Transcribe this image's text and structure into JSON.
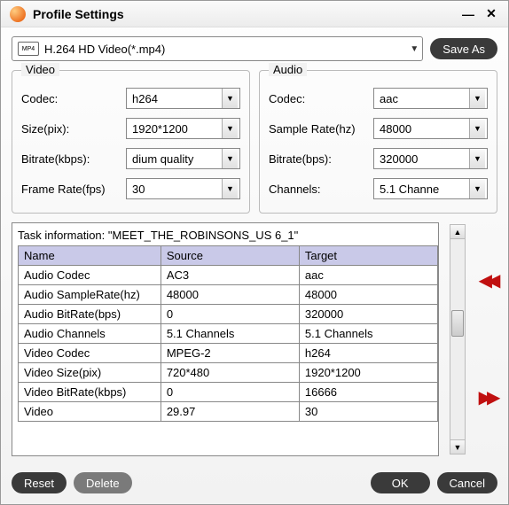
{
  "window": {
    "title": "Profile Settings"
  },
  "topbar": {
    "profile_label": "H.264 HD Video(*.mp4)",
    "format_badge": "MP4",
    "save_as_label": "Save As"
  },
  "video": {
    "legend": "Video",
    "codec_label": "Codec:",
    "codec_value": "h264",
    "size_label": "Size(pix):",
    "size_value": "1920*1200",
    "bitrate_label": "Bitrate(kbps):",
    "bitrate_value": "dium quality",
    "fps_label": "Frame Rate(fps)",
    "fps_value": "30"
  },
  "audio": {
    "legend": "Audio",
    "codec_label": "Codec:",
    "codec_value": "aac",
    "sample_label": "Sample Rate(hz)",
    "sample_value": "48000",
    "bitrate_label": "Bitrate(bps):",
    "bitrate_value": "320000",
    "channels_label": "Channels:",
    "channels_value": "5.1 Channe"
  },
  "task": {
    "info_label": "Task information: \"MEET_THE_ROBINSONS_US 6_1\"",
    "headers": {
      "name": "Name",
      "source": "Source",
      "target": "Target"
    },
    "rows": {
      "r0": {
        "n": "Audio Codec",
        "s": "AC3",
        "t": "aac"
      },
      "r1": {
        "n": "Audio SampleRate(hz)",
        "s": "48000",
        "t": "48000"
      },
      "r2": {
        "n": "Audio BitRate(bps)",
        "s": "0",
        "t": "320000"
      },
      "r3": {
        "n": "Audio Channels",
        "s": "5.1 Channels",
        "t": "5.1 Channels"
      },
      "r4": {
        "n": "Video Codec",
        "s": "MPEG-2",
        "t": "h264"
      },
      "r5": {
        "n": "Video Size(pix)",
        "s": "720*480",
        "t": "1920*1200"
      },
      "r6": {
        "n": "Video BitRate(kbps)",
        "s": "0",
        "t": "16666"
      },
      "r7": {
        "n": "Video",
        "s": "29.97",
        "t": "30"
      }
    }
  },
  "buttons": {
    "reset": "Reset",
    "delete": "Delete",
    "ok": "OK",
    "cancel": "Cancel"
  }
}
